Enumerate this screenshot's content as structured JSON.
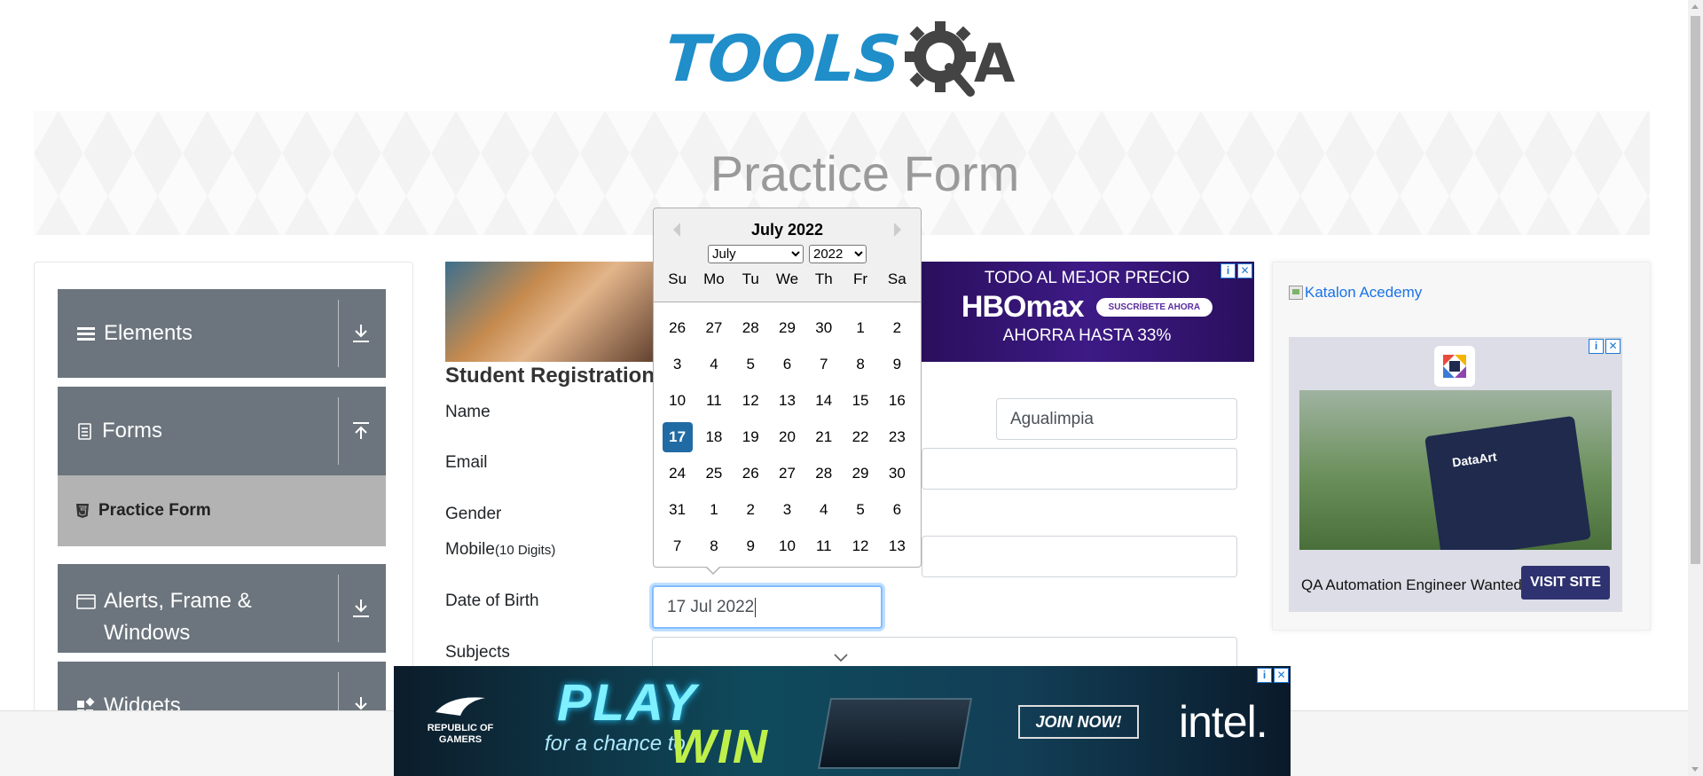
{
  "logo": {
    "text": "TOOLS",
    "suffix": "A"
  },
  "banner": {
    "title": "Practice Form"
  },
  "sidebar": {
    "groups": [
      {
        "label": "Elements",
        "icon": "hamburger-icon",
        "toggle": "download-icon"
      },
      {
        "label": "Forms",
        "icon": "document-icon",
        "toggle": "upload-icon"
      },
      {
        "label": "Alerts, Frame &",
        "label2": "Windows",
        "icon": "window-icon",
        "toggle": "download-icon"
      },
      {
        "label": "Widgets",
        "icon": "widgets-icon",
        "toggle": "download-icon"
      }
    ],
    "active_item": {
      "label": "Practice Form",
      "icon": "html5-icon"
    }
  },
  "ad_top": {
    "line1": "TODO AL MEJOR PRECIO",
    "brand": "HBOmax",
    "cta": "SUSCRÍBETE AHORA",
    "line3": "AHORRA HASTA 33%"
  },
  "form": {
    "section_title": "Student Registration",
    "name_label": "Name",
    "last_name_value": "Agualimpia",
    "email_label": "Email",
    "gender_label": "Gender",
    "mobile_label": "Mobile",
    "mobile_hint": "(10 Digits)",
    "dob_label": "Date of Birth",
    "dob_value": "17 Jul 2022",
    "subjects_label": "Subjects"
  },
  "datepicker": {
    "header": "July 2022",
    "month_select": "July",
    "year_select": "2022",
    "dows": [
      "Su",
      "Mo",
      "Tu",
      "We",
      "Th",
      "Fr",
      "Sa"
    ],
    "weeks": [
      [
        "26",
        "27",
        "28",
        "29",
        "30",
        "1",
        "2"
      ],
      [
        "3",
        "4",
        "5",
        "6",
        "7",
        "8",
        "9"
      ],
      [
        "10",
        "11",
        "12",
        "13",
        "14",
        "15",
        "16"
      ],
      [
        "17",
        "18",
        "19",
        "20",
        "21",
        "22",
        "23"
      ],
      [
        "24",
        "25",
        "26",
        "27",
        "28",
        "29",
        "30"
      ],
      [
        "31",
        "1",
        "2",
        "3",
        "4",
        "5",
        "6"
      ],
      [
        "7",
        "8",
        "9",
        "10",
        "11",
        "12",
        "13"
      ]
    ],
    "selected": "17"
  },
  "right_ad": {
    "link_text": "Katalon Acedemy",
    "brand": "DataArt",
    "job": "QA Automation Engineer Wanted",
    "cta": "VISIT SITE"
  },
  "bottom_ad": {
    "brand": "REPUBLIC OF GAMERS",
    "play": "PLAY",
    "chance": "for a chance to",
    "win": "WIN",
    "cta": "JOIN NOW!",
    "partner": "intel."
  }
}
